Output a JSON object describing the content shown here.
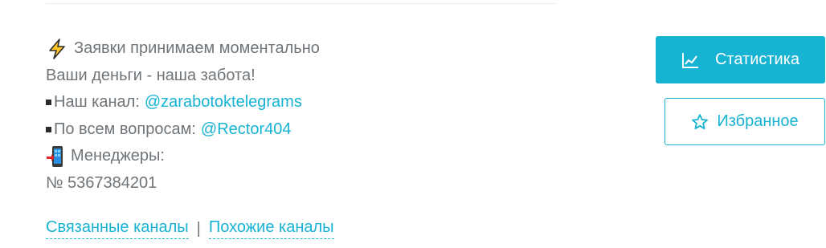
{
  "description": {
    "line1": {
      "icon": "lightning-icon",
      "text": "Заявки принимаем моментально"
    },
    "line2": {
      "text": "Ваши деньги - наша забота!"
    },
    "line3": {
      "icon": "square-bullet-icon",
      "prefix": "Наш канал:",
      "link": "@zarabotoktelegrams"
    },
    "line4": {
      "icon": "square-bullet-icon",
      "prefix": "По всем вопросам:",
      "link": "@Rector404"
    },
    "line5": {
      "icon": "phone-with-arrow-icon",
      "text": "Менеджеры:"
    },
    "line6": {
      "text": "№ 5367384201"
    }
  },
  "related": {
    "related_channels": "Связанные каналы",
    "separator": "|",
    "similar_channels": "Похожие каналы"
  },
  "actions": {
    "stats_label": "Статистика",
    "stats_icon": "line-chart-icon",
    "favorite_label": "Избранное",
    "favorite_icon": "star-outline-icon"
  },
  "colors": {
    "accent": "#17b3d3",
    "text": "#6f7478",
    "divider": "#ececec"
  }
}
